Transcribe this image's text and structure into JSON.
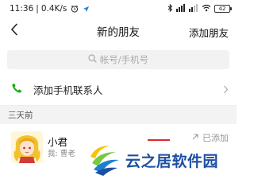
{
  "status_bar": {
    "time": "11:36",
    "speed": "0.4K/s",
    "battery": "42"
  },
  "nav": {
    "title": "新的朋友",
    "action": "添加朋友"
  },
  "search": {
    "placeholder": "帐号/手机号"
  },
  "add_contacts": {
    "label": "添加手机联系人"
  },
  "section": {
    "label": "三天前"
  },
  "friends": [
    {
      "name": "小君",
      "message": "我: 曹老",
      "status": "已添加"
    }
  ],
  "watermark": {
    "text": "云之居软件园"
  },
  "colors": {
    "contact_icon": "#1aad19",
    "watermark_text": "#1d4fa3",
    "section_bg": "#f3f3f3",
    "search_bg": "#f2f2f2"
  }
}
